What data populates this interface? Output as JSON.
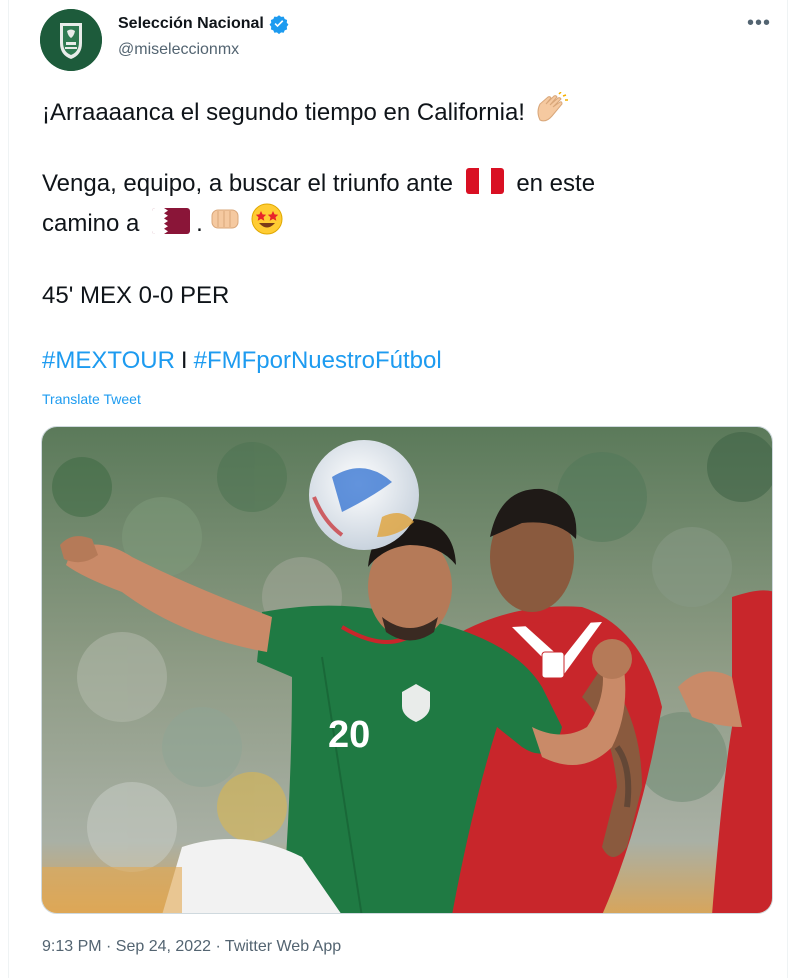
{
  "author": {
    "display_name": "Selección Nacional",
    "handle": "@miseleccionmx",
    "verified": true
  },
  "tweet": {
    "line1": "¡Arraaaanca el segundo tiempo en California!",
    "line2_a": "Venga, equipo, a buscar el triunfo ante",
    "line2_b": "en este",
    "line3_a": "camino a",
    "line3_b": ".",
    "score": "45' MEX 0-0 PER",
    "hashtag1": "#MEXTOUR",
    "separator": "I",
    "hashtag2": "#FMFporNuestroFútbol",
    "translate_label": "Translate Tweet"
  },
  "emojis": {
    "clap": "clapping-hands",
    "peru_flag": "flag-peru",
    "qatar_flag": "flag-qatar",
    "fist": "oncoming-fist",
    "star_eyes": "star-struck-face"
  },
  "media": {
    "jersey_number": "20"
  },
  "footer": {
    "timestamp": "9:13 PM · Sep 24, 2022 · Twitter Web App"
  },
  "colors": {
    "link": "#1d9bf0",
    "text": "#0f1419",
    "muted": "#536471",
    "verified": "#1d9bf0",
    "mexico_green": "#1f7a43",
    "peru_red": "#c8262b"
  }
}
